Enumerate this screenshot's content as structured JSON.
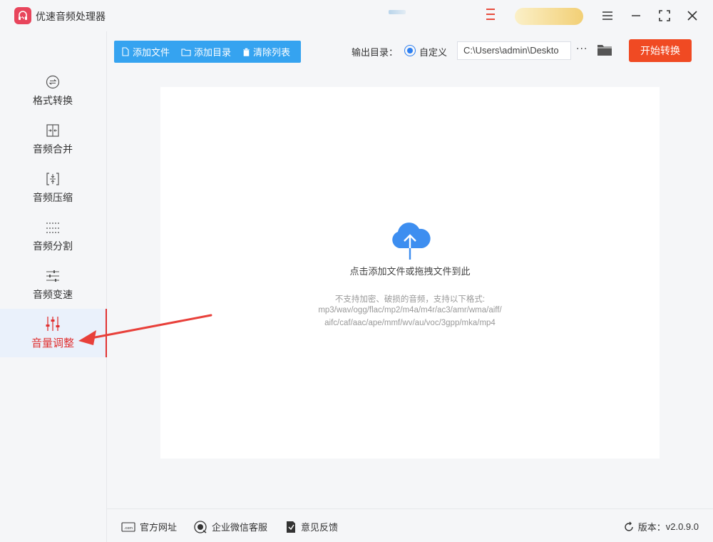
{
  "app": {
    "title": "优速音频处理器"
  },
  "sidebar": {
    "items": [
      {
        "label": "格式转换",
        "icon": "swap-circle-icon"
      },
      {
        "label": "音频合并",
        "icon": "merge-icon"
      },
      {
        "label": "音频压缩",
        "icon": "compress-icon"
      },
      {
        "label": "音频分割",
        "icon": "split-icon"
      },
      {
        "label": "音频变速",
        "icon": "speed-sliders-icon"
      },
      {
        "label": "音量调整",
        "icon": "volume-sliders-icon",
        "active": true
      }
    ]
  },
  "toolbar": {
    "add_file": "添加文件",
    "add_dir": "添加目录",
    "clear_list": "清除列表",
    "output_label": "输出目录：",
    "custom_label": "自定义",
    "output_path": "C:\\Users\\admin\\Deskto",
    "more": "···",
    "start": "开始转换"
  },
  "dropzone": {
    "hint": "点击添加文件或拖拽文件到此",
    "formats_intro": "不支持加密、破损的音频，支持以下格式:",
    "formats_line1": "mp3/wav/ogg/flac/mp2/m4a/m4r/ac3/amr/wma/aiff/",
    "formats_line2": "aifc/caf/aac/ape/mmf/wv/au/voc/3gpp/mka/mp4"
  },
  "footer": {
    "website": "官方网址",
    "wechat_service": "企业微信客服",
    "feedback": "意见反馈",
    "version_label": "版本：",
    "version": "v2.0.9.0"
  },
  "colors": {
    "accent_blue": "#35a3f0",
    "start_orange": "#f04a23",
    "active_red": "#e03232",
    "cloud_blue": "#3d8ef0"
  }
}
